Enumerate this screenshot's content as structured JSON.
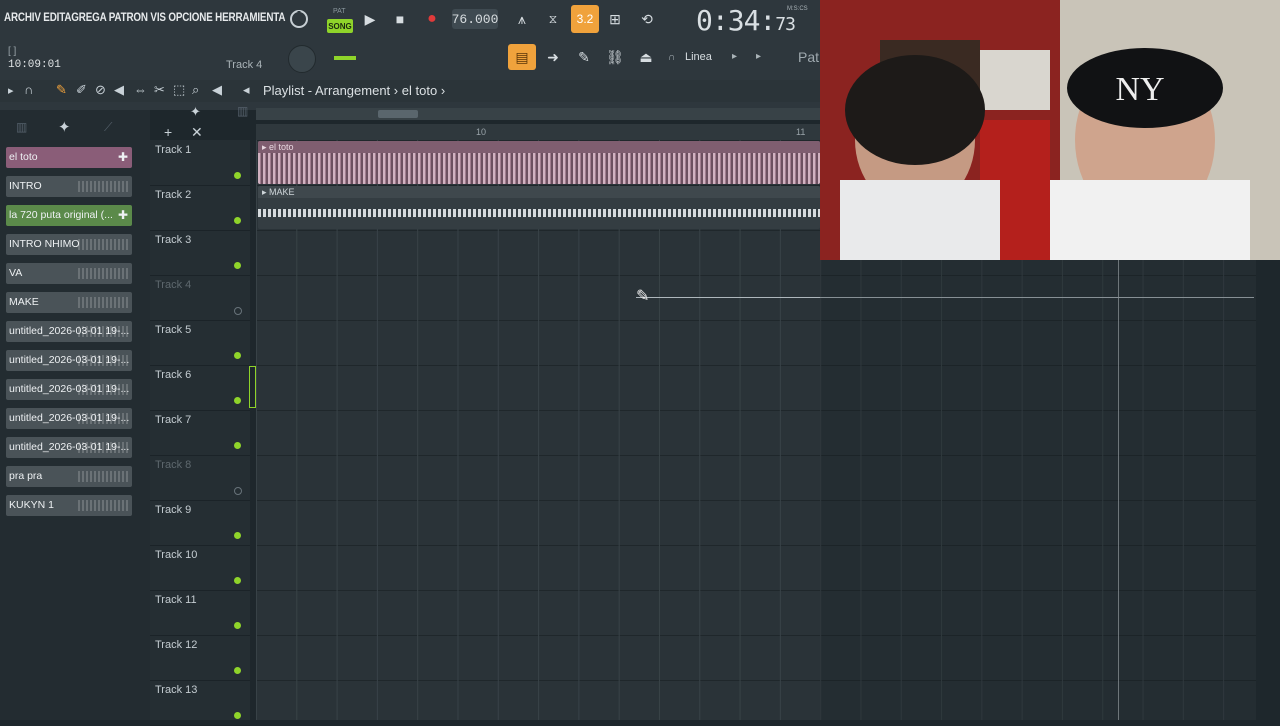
{
  "menu": {
    "text": "ARCHIV EDITAGREGA PATRON VIS OPCIONE HERRAMIENTA"
  },
  "transport": {
    "song_label": "SONG",
    "pat_label": "PAT",
    "bpm": "76.000",
    "time_main": "0:34:",
    "time_sub": "73",
    "time_unit": "M:S:CS",
    "snap_value": "3.2"
  },
  "hint": {
    "top": "[ ]",
    "bottom": "10:09:01"
  },
  "toolbar2": {
    "track_indicator": "Track 4",
    "snap_mode": "Linea",
    "pat_label": "Pat"
  },
  "playlist": {
    "breadcrumb_root": "Playlist - Arrangement",
    "breadcrumb_sep": "›",
    "breadcrumb_item": "el toto",
    "ruler": [
      "10",
      "11"
    ]
  },
  "patterns": [
    {
      "label": "el toto",
      "style": "sel"
    },
    {
      "label": "INTRO",
      "style": "plain"
    },
    {
      "label": "la 720 puta original (...",
      "style": "green"
    },
    {
      "label": "INTRO NHIMO",
      "style": "plain"
    },
    {
      "label": "VA",
      "style": "plain"
    },
    {
      "label": "MAKE",
      "style": "plain"
    },
    {
      "label": "untitled_2026-03-01 19-...",
      "style": "plain"
    },
    {
      "label": "untitled_2026-03-01 19-...",
      "style": "plain"
    },
    {
      "label": "untitled_2026-03-01 19-...",
      "style": "plain"
    },
    {
      "label": "untitled_2026-03-01 19-...",
      "style": "plain"
    },
    {
      "label": "untitled_2026-03-01 19-...",
      "style": "plain"
    },
    {
      "label": "pra pra",
      "style": "plain"
    },
    {
      "label": "KUKYN 1",
      "style": "plain"
    }
  ],
  "tracks": [
    {
      "name": "Track 1",
      "active": true
    },
    {
      "name": "Track 2",
      "active": true
    },
    {
      "name": "Track 3",
      "active": true
    },
    {
      "name": "Track 4",
      "active": false
    },
    {
      "name": "Track 5",
      "active": true
    },
    {
      "name": "Track 6",
      "active": true
    },
    {
      "name": "Track 7",
      "active": true
    },
    {
      "name": "Track 8",
      "active": false
    },
    {
      "name": "Track 9",
      "active": true
    },
    {
      "name": "Track 10",
      "active": true
    },
    {
      "name": "Track 11",
      "active": true
    },
    {
      "name": "Track 12",
      "active": true
    },
    {
      "name": "Track 13",
      "active": true
    }
  ],
  "clips": {
    "clip1": "el toto",
    "clip2": "MAKE"
  },
  "colors": {
    "accent_green": "#8fd42a",
    "record_red": "#e03a3a",
    "snap_orange": "#f0a23c"
  }
}
